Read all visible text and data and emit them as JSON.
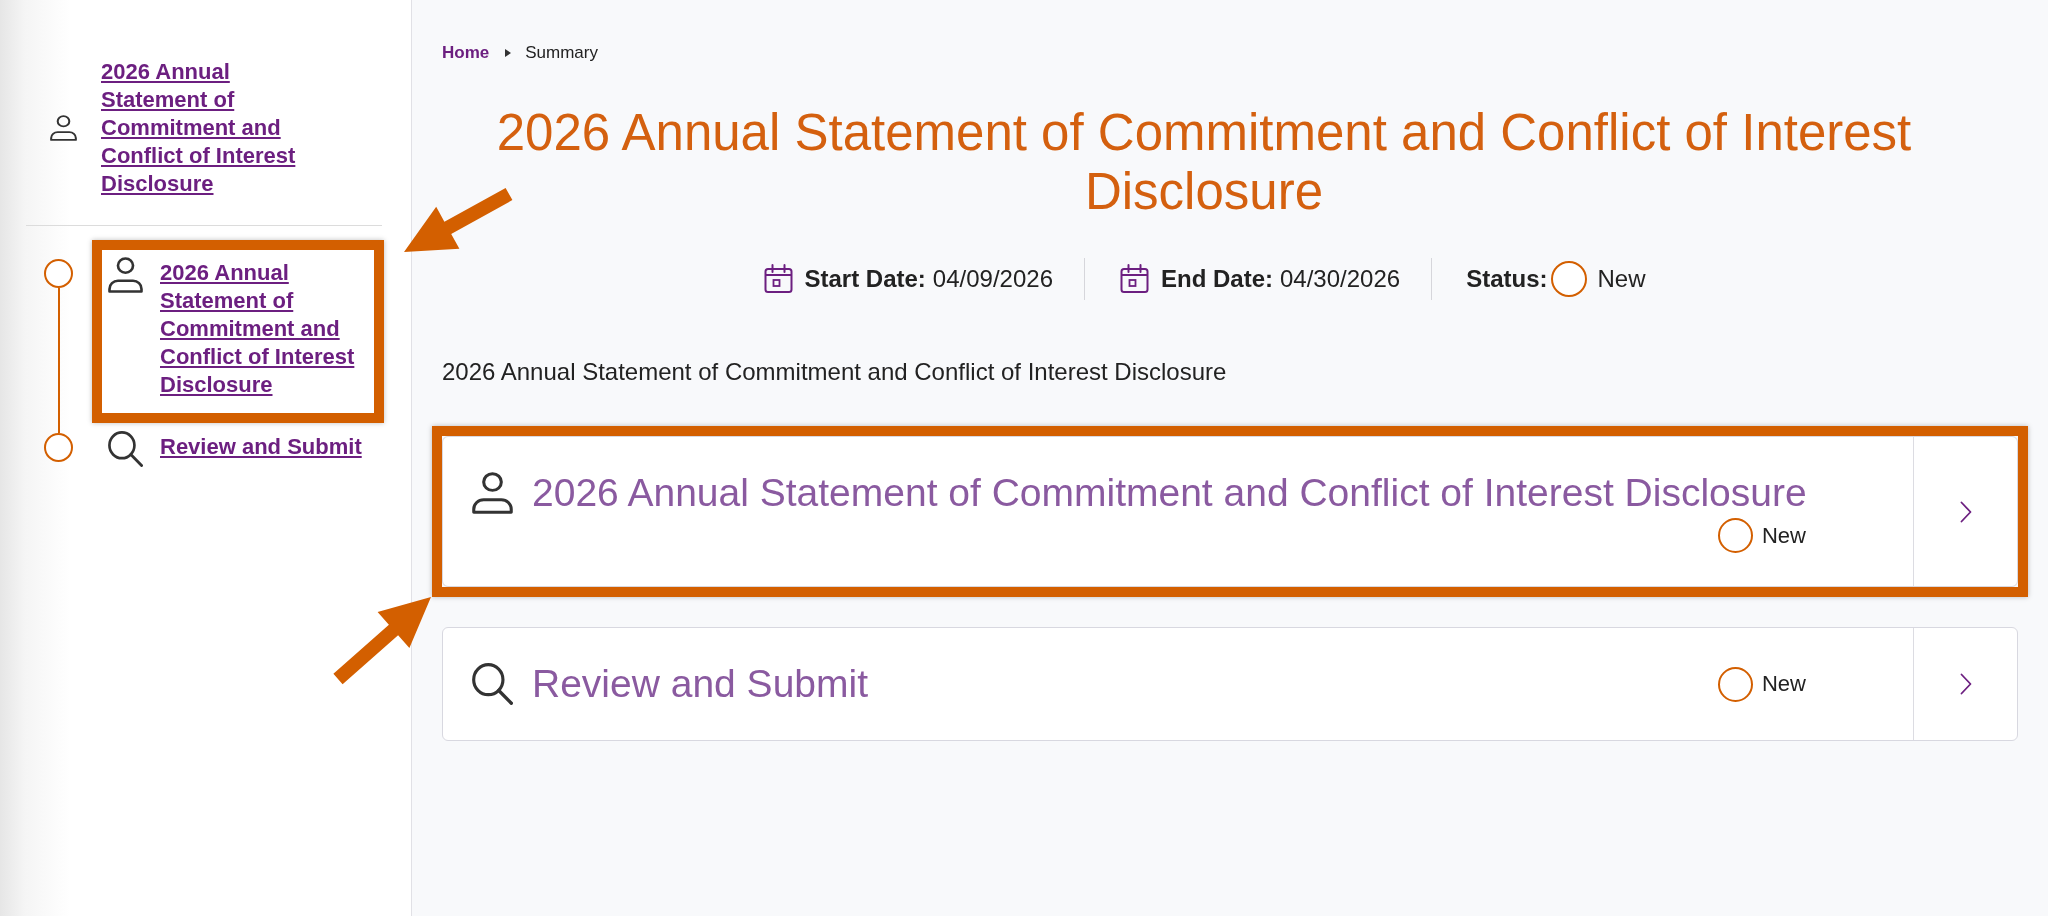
{
  "sidebar": {
    "form_link": "2026 Annual Statement of Commitment and Conflict of Interest Disclosure",
    "steps": [
      {
        "kind": "form",
        "label": "2026 Annual Statement of Commitment and Conflict of Interest Disclosure",
        "highlighted": true
      },
      {
        "kind": "review",
        "label": "Review and Submit",
        "highlighted": false
      }
    ]
  },
  "breadcrumb": [
    {
      "label": "Home",
      "current": false
    },
    {
      "label": "Summary",
      "current": true
    }
  ],
  "title": "2026 Annual Statement of Commitment and Conflict of Interest Disclosure",
  "meta": [
    {
      "kind": "date",
      "label": "Start Date:",
      "value": "04/09/2026"
    },
    {
      "kind": "date",
      "label": "End Date:",
      "value": "04/30/2026"
    },
    {
      "kind": "status",
      "label": "Status:",
      "value": "New"
    }
  ],
  "description": "2026 Annual Statement of Commitment and Conflict of Interest Disclosure",
  "cards": [
    {
      "kind": "form",
      "title": "2026 Annual Statement of Commitment and Conflict of Interest Disclosure",
      "status": "New",
      "highlighted": true
    },
    {
      "kind": "review",
      "title": "Review and Submit",
      "status": "New",
      "highlighted": false
    }
  ]
}
